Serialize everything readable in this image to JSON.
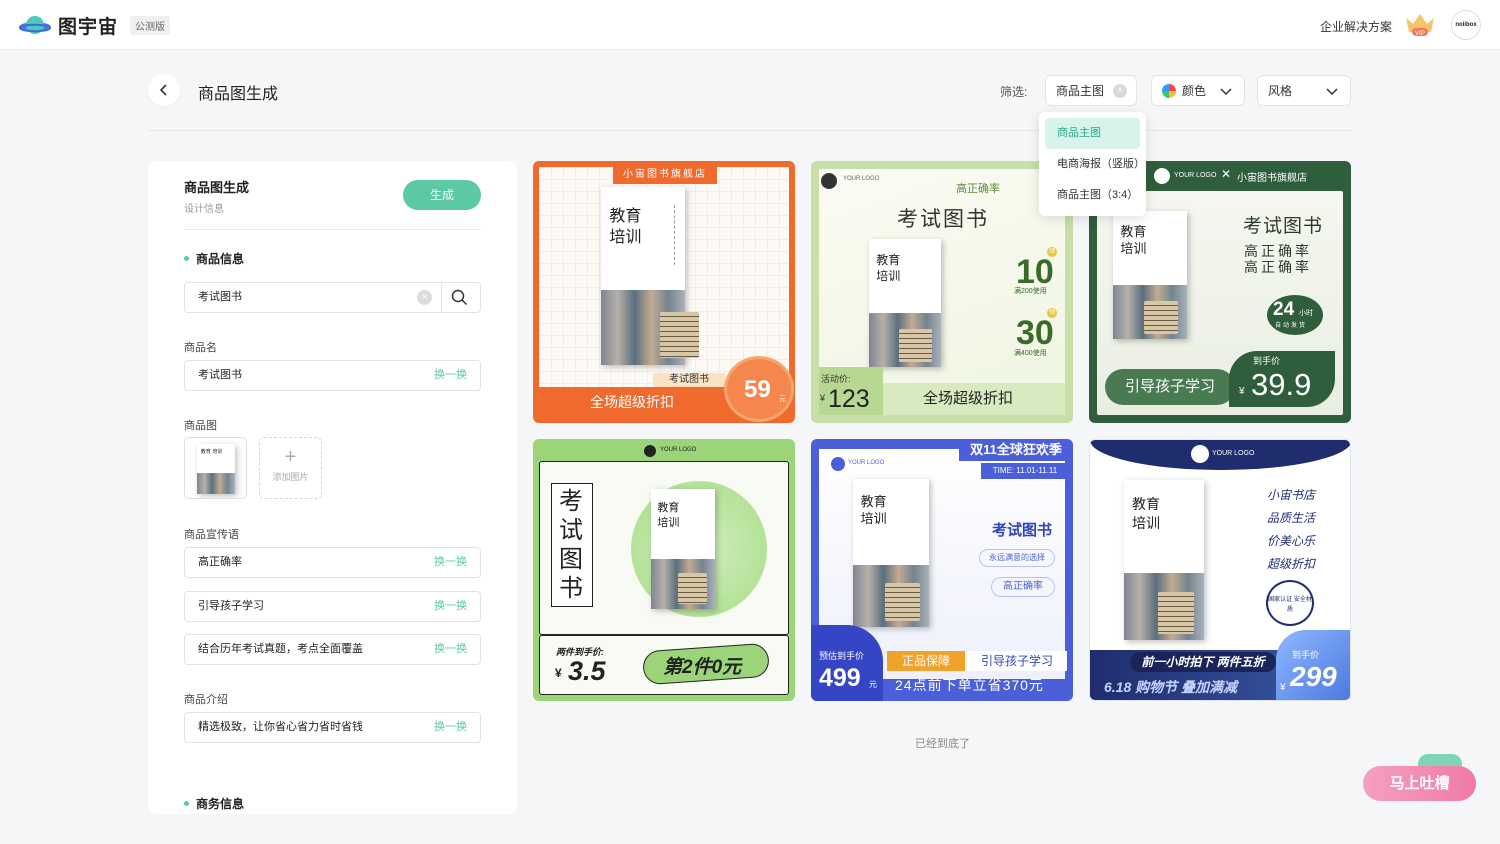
{
  "header": {
    "brand": "图宇宙",
    "beta_label": "公测版",
    "enterprise_link": "企业解决方案",
    "vip_label": "VIP",
    "avatar_text": "nolibox"
  },
  "toolbar": {
    "title": "商品图生成",
    "filter_label": "筛选:",
    "filter_type_value": "商品主图",
    "filter_color_label": "颜色",
    "filter_style_label": "风格"
  },
  "dropdown": {
    "options": [
      "商品主图",
      "电商海报（竖版）",
      "商品主图（3:4）"
    ],
    "selected_index": 0
  },
  "panel": {
    "title": "商品图生成",
    "subtitle": "设计信息",
    "generate_label": "生成",
    "product_section": "商品信息",
    "search_value": "考试图书",
    "name_label": "商品名",
    "name_value": "考试图书",
    "swap_label": "换一换",
    "image_label": "商品图",
    "add_image_label": "添加图片",
    "slogan_label": "商品宣传语",
    "slogans": [
      "高正确率",
      "引导孩子学习",
      "结合历年考试真题，考点全面覆盖"
    ],
    "intro_label": "商品介绍",
    "intro_value": "精选极致，让你省心省力省时省钱",
    "business_section": "商务信息"
  },
  "book": {
    "title_line1": "教育",
    "title_line2": "培训",
    "thumb_title": "教育 培训"
  },
  "cards": {
    "c1": {
      "shop": "小宙图书旗舰店",
      "name_tag": "考试图书",
      "bottom": "全场超级折扣",
      "price": "59",
      "unit": "元",
      "accent": "#f06a2e"
    },
    "c2": {
      "logo": "YOUR LOGO",
      "tagline": "高正确率",
      "headline": "考试图书",
      "coupon1": "10",
      "coupon1_note": "满200使用",
      "coupon2": "30",
      "coupon2_note": "满400使用",
      "coupon_tag": "领",
      "activity_label": "活动价:",
      "price": "123",
      "currency": "¥",
      "bottom": "全场超级折扣",
      "accent": "#a8d28a"
    },
    "c3": {
      "logo": "YOUR LOGO",
      "shop": "小宙图书旗舰店",
      "headline": "考试图书",
      "line1": "高正确率",
      "line2": "高正确率",
      "hours": "24",
      "hours_unit": "小时",
      "ship": "自动发货",
      "slogan": "引导孩子学习",
      "price_label": "到手价",
      "price": "39.9",
      "currency": "¥",
      "accent": "#2f5e3c"
    },
    "c4": {
      "logo": "YOUR LOGO",
      "vertical": "考试图书",
      "price_label": "两件到手价:",
      "price": "3.5",
      "currency": "¥",
      "promo": "第2件0元",
      "accent": "#9bd479"
    },
    "c5": {
      "banner": "双11全球狂欢季",
      "time": "TIME: 11.01-11.11",
      "logo": "YOUR LOGO",
      "headline": "考试图书",
      "pill1": "永远满意的选择",
      "pill2": "高正确率",
      "price_label": "预估到手价",
      "price": "499",
      "unit": "元",
      "badge1": "正品保障",
      "badge2": "引导孩子学习",
      "bottom": "24点前下单立省370元",
      "accent": "#4a5fd8"
    },
    "c6": {
      "logo": "YOUR LOGO",
      "side1": "小宙书店",
      "side2": "品质生活",
      "side3": "价美心乐",
      "side4": "超级折扣",
      "seal": "国家认证 安全材质",
      "promo": "前一小时拍下 两件五折",
      "festival": "6.18 购物节 叠加满减",
      "price_label": "到手价",
      "price": "299",
      "currency": "¥",
      "accent": "#1f2d6e"
    }
  },
  "footer": {
    "end_note": "已经到底了",
    "feedback": "马上吐槽"
  }
}
